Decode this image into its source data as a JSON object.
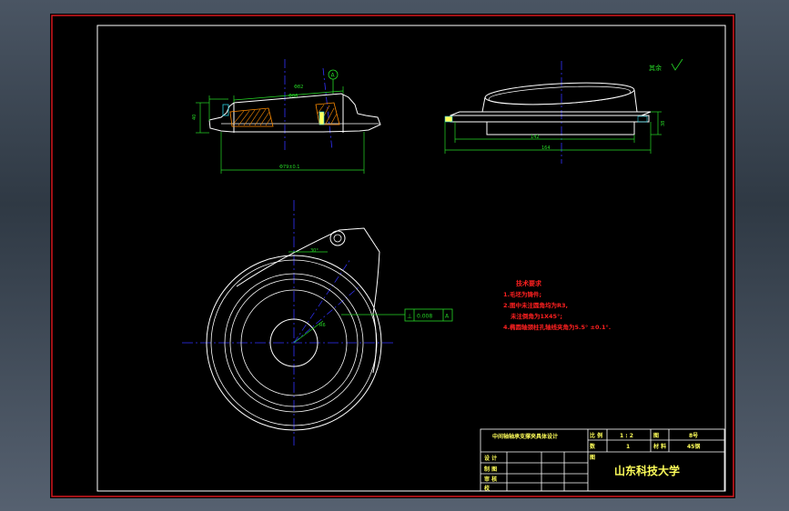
{
  "colors": {
    "background": "#000000",
    "frame": "#d6171e",
    "outline": "#ffffff",
    "dimension": "#26d926",
    "centerline": "#3232ff",
    "annotation": "#ff2020",
    "hatch": "#ff8c00",
    "cyan": "#27d0e0",
    "title_text": "#ffff5a"
  },
  "section_view": {
    "datum_label": "A",
    "dim_top": "Φ86",
    "dim_top2": "Φ82",
    "dim_bottom": "Φ79±0.1",
    "dim_height": "40"
  },
  "side_view": {
    "dim_inner": "142",
    "dim_outer": "164",
    "dim_height": "38"
  },
  "roughness_note": "其余",
  "plan_view": {
    "angle_label": "30°",
    "radius_label": "R6",
    "tolerance_symbol": "⊥",
    "tolerance_value": "0.008",
    "tolerance_datum": "A"
  },
  "tech_requirements": {
    "title": "技术要求",
    "items": [
      "1.毛坯为铸件;",
      "2.图中未注圆角均为R3,",
      "未注倒角为1X45°;",
      "4.椭圆轴颈柱孔轴线夹角为5.5° ±0.1°."
    ]
  },
  "title_block": {
    "drawing_title": "中间轴轴承支撑夹具体设计",
    "scale_label": "比 例",
    "scale_value": "1 : 2",
    "sheet_label": "图",
    "sheet_value": "8号",
    "qty_label": "数",
    "qty_value": "1",
    "material_label": "材 料",
    "material_value": "45钢",
    "designer_label": "设 计",
    "drafter_label": "制 图",
    "checker_label": "审 核",
    "approver_label": "校",
    "school_label": "图",
    "university": "山东科技大学"
  }
}
